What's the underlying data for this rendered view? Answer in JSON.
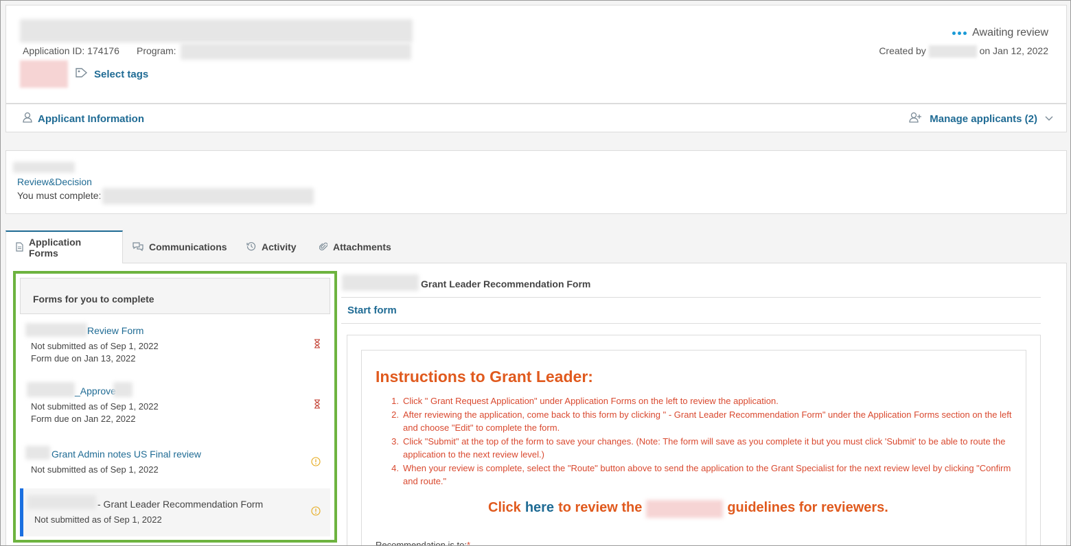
{
  "header": {
    "app_id": "Application ID: 174176",
    "program_label": "Program:",
    "status": "Awaiting review",
    "created_by_label": "Created by",
    "created_on": "on Jan 12, 2022",
    "select_tags": "Select tags"
  },
  "applicant_bar": {
    "applicant_info": "Applicant Information",
    "manage_applicants": "Manage applicants (2)"
  },
  "review": {
    "link": "Review&Decision",
    "must_complete": "You must complete:"
  },
  "tabs": [
    {
      "label": "Application Forms",
      "icon": "document-icon"
    },
    {
      "label": "Communications",
      "icon": "chat-icon"
    },
    {
      "label": "Activity",
      "icon": "history-icon"
    },
    {
      "label": "Attachments",
      "icon": "paperclip-icon"
    }
  ],
  "forms_panel": {
    "heading": "Forms for you to complete",
    "items": [
      {
        "title": "Review Form",
        "status": "Not submitted as of Sep 1, 2022",
        "due": "Form due on Jan 13, 2022",
        "icon": "hourglass-icon"
      },
      {
        "title": "_Approve",
        "status": "Not submitted as of Sep 1, 2022",
        "due": "Form due on Jan 22, 2022",
        "icon": "hourglass-icon"
      },
      {
        "title": "Grant Admin notes US Final review",
        "status": "Not submitted as of Sep 1, 2022",
        "icon": "info-icon"
      },
      {
        "title": "- Grant Leader Recommendation Form",
        "status": "Not submitted as of Sep 1, 2022",
        "icon": "info-icon"
      }
    ]
  },
  "content": {
    "form_title": "Grant Leader Recommendation Form",
    "start_form": "Start form",
    "instructions_title": "Instructions to Grant Leader:",
    "steps": [
      "Click \" Grant Request Application\" under Application Forms on the left to review the application.",
      "After reviewing the application, come back to this form by clicking \" - Grant Leader Recommendation Form\" under the Application Forms section on the left and choose \"Edit\" to complete the form.",
      "Click \"Submit\" at the top of the form to save your changes. (Note: The form will save as you complete it but you must click 'Submit' to be able to route the application to the next review level.)",
      "When your review is complete, select the \"Route\" button above to send the application to the Grant Specialist for the next review level by clicking \"Confirm and route.\""
    ],
    "click_prefix": "Click",
    "here": "here",
    "click_mid": "to review the",
    "click_suffix": "guidelines for reviewers.",
    "recommendation": "Recommendation is to:"
  },
  "colors": {
    "link": "#1f6b94",
    "accent_green": "#6db33f",
    "instruction_orange": "#e05a1e",
    "instruction_red": "#d9492f",
    "selected_bar": "#1a6fe0"
  }
}
